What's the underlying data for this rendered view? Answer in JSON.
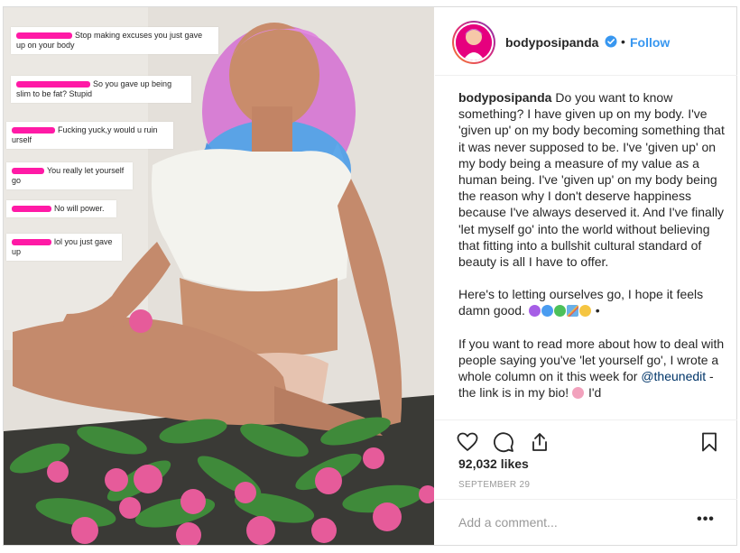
{
  "photo": {
    "comments": [
      {
        "text": "Stop making excuses you just gave up on your body"
      },
      {
        "text": "So you gave up being slim to be fat? Stupid"
      },
      {
        "text": "Fucking yuck,y would u ruin urself"
      },
      {
        "text": "You really let yourself go"
      },
      {
        "text": "No will power."
      },
      {
        "text": "lol you just gave up"
      }
    ]
  },
  "header": {
    "username": "bodyposipanda",
    "separator": "•",
    "follow_label": "Follow"
  },
  "caption": {
    "username": "bodyposipanda",
    "para1": "Do you want to know something? I have given up on my body. I've 'given up' on my body becoming something that it was never supposed to be. I've 'given up' on my body being a measure of my value as a human being. I've 'given up' on my body being the reason why I don't deserve happiness because I've always deserved it. And I've finally 'let myself go' into the world without believing that fitting into a bullshit cultural standard of beauty is all I have to offer.",
    "para2": "Here's to letting ourselves go, I hope it feels damn good.",
    "para2_tail": "•",
    "para3_pre": "If you want to read more about how to deal with people saying you've 'let yourself go', I wrote a whole column on it this week for",
    "mention": "@theunedit",
    "para3_post": "- the link is in my bio!",
    "para3_tail": "I'd"
  },
  "likes": "92,032 likes",
  "date": "SEPTEMBER 29",
  "comment_placeholder": "Add a comment...",
  "more_label": "•••",
  "icons": {
    "like": "heart-icon",
    "comment": "comment-icon",
    "share": "share-icon",
    "save": "bookmark-icon",
    "verified": "verified-badge-icon"
  },
  "colors": {
    "link": "#3897f0",
    "redaction": "#ff1aa6",
    "muted": "#999999"
  }
}
